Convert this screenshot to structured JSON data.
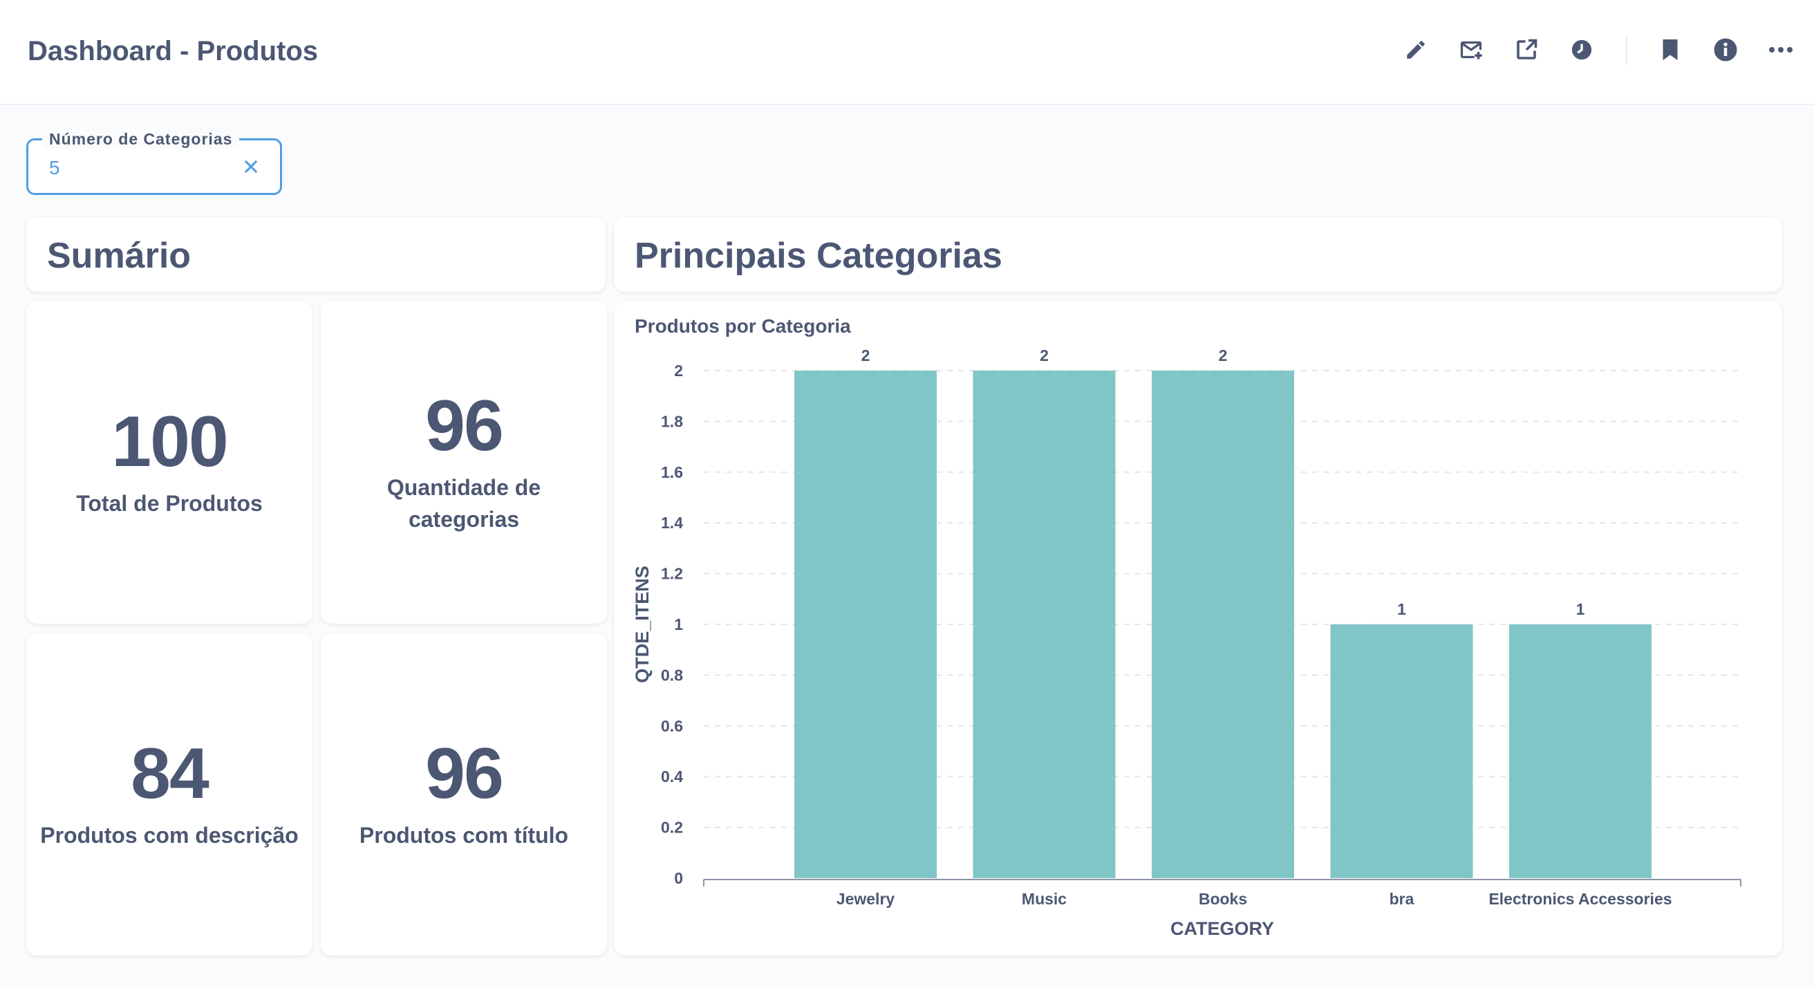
{
  "header": {
    "title": "Dashboard - Produtos",
    "icons": [
      "edit-icon",
      "subscription-icon",
      "share-icon",
      "history-icon",
      "bookmark-icon",
      "info-icon",
      "more-icon"
    ]
  },
  "filter": {
    "label": "Número de Categorias",
    "value": "5"
  },
  "summary": {
    "heading": "Sumário",
    "cards": [
      {
        "value": "100",
        "label": "Total de Produtos"
      },
      {
        "value": "96",
        "label": "Quantidade de categorias"
      },
      {
        "value": "84",
        "label": "Produtos com descrição"
      },
      {
        "value": "96",
        "label": "Produtos com título"
      }
    ]
  },
  "categories": {
    "heading": "Principais Categorias"
  },
  "colors": {
    "bar": "#80c6c6",
    "text": "#4c5773",
    "accent": "#509ee3"
  },
  "chart_data": {
    "type": "bar",
    "title": "Produtos por Categoria",
    "xlabel": "CATEGORY",
    "ylabel": "QTDE_ITENS",
    "categories": [
      "Jewelry",
      "Music",
      "Books",
      "bra",
      "Electronics Accessories"
    ],
    "values": [
      2,
      2,
      2,
      1,
      1
    ],
    "ylim": [
      0,
      2
    ],
    "yticks": [
      "0",
      "0.2",
      "0.4",
      "0.6",
      "0.8",
      "1",
      "1.2",
      "1.4",
      "1.6",
      "1.8",
      "2"
    ],
    "grid": true
  }
}
